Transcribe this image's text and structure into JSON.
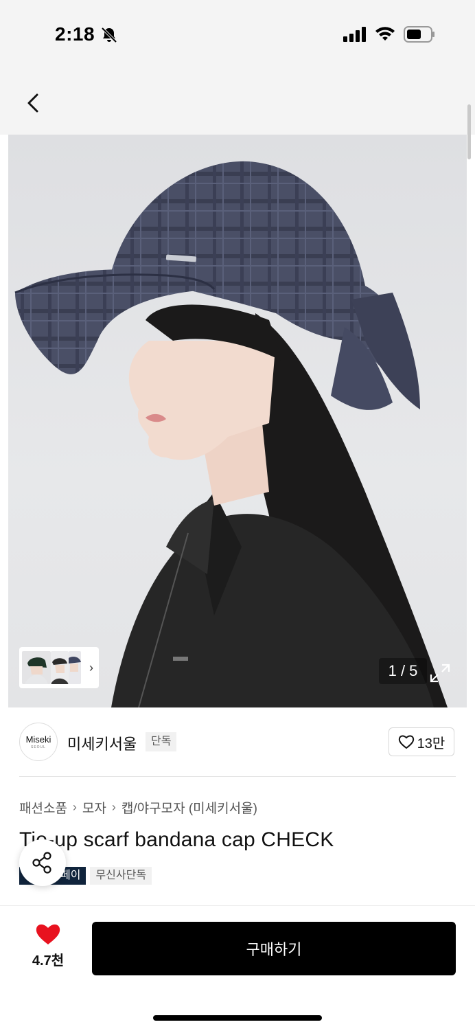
{
  "status_bar": {
    "time": "2:18"
  },
  "gallery": {
    "counter": "1 / 5"
  },
  "brand": {
    "logo_text": "Miseki",
    "logo_sub": "SEOUL",
    "name": "미세키서울",
    "tag": "단독",
    "likes": "13만"
  },
  "breadcrumb": [
    "패션소품",
    "모자",
    "캡/야구모자 (미세키서울)"
  ],
  "product": {
    "title": "Tie-up scarf bandana cap CHECK",
    "badge_pay": "페이",
    "badge_exclusive": "무신사단독"
  },
  "bottom": {
    "wish_count": "4.7천",
    "buy_label": "구매하기"
  },
  "colors": {
    "heart": "#e8121f",
    "buy_bg": "#000000",
    "pay_badge": "#10243c"
  }
}
